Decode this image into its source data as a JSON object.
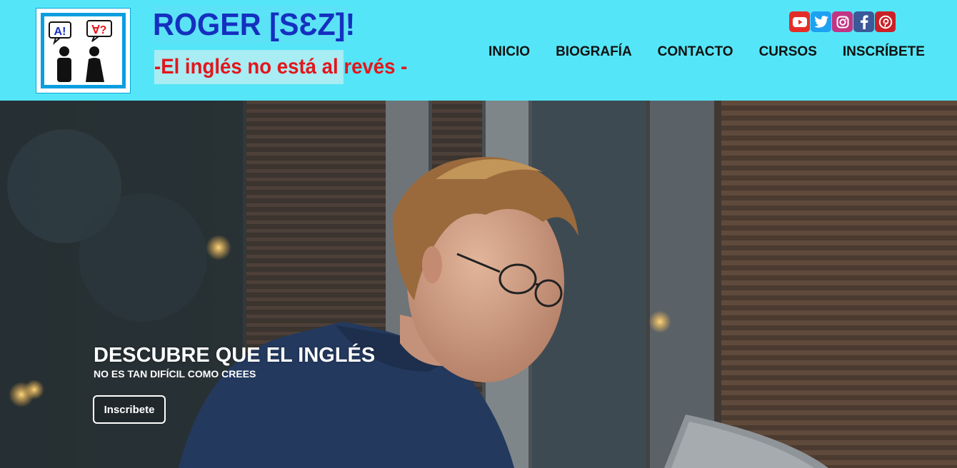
{
  "brand": {
    "title": "ROGER [SƐZ]!",
    "tagline": "-El inglés no está al revés -",
    "logo_bubble_left": "A!",
    "logo_bubble_right": "∀?"
  },
  "social": [
    {
      "name": "youtube-icon",
      "color": "#e52d27"
    },
    {
      "name": "twitter-icon",
      "color": "#1da1f2"
    },
    {
      "name": "instagram-icon",
      "color": "#c13584"
    },
    {
      "name": "facebook-icon",
      "color": "#3b5998"
    },
    {
      "name": "pinterest-icon",
      "color": "#cb2027"
    }
  ],
  "nav": [
    "INICIO",
    "BIOGRAFÍA",
    "CONTACTO",
    "CURSOS",
    "INSCRÍBETE"
  ],
  "hero": {
    "title": "DESCUBRE QUE EL INGLÉS",
    "subtitle": "NO ES TAN DIFÍCIL COMO CREES",
    "button": "Inscribete"
  },
  "colors": {
    "header_bg": "#54e6f8",
    "brand_blue": "#1430c0",
    "brand_red": "#e3161b"
  }
}
